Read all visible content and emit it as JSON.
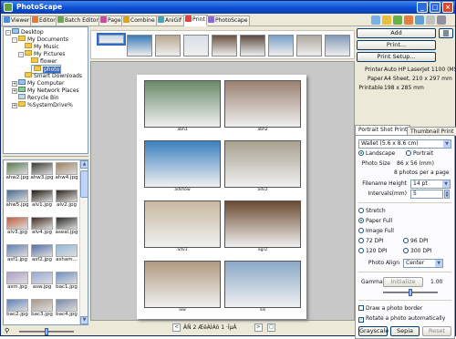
{
  "window": {
    "title": "PhotoScape",
    "min": "_",
    "max": "□",
    "close": "×"
  },
  "tabs": [
    {
      "label": "Viewer",
      "color": "#4c8adf"
    },
    {
      "label": "Editor",
      "color": "#e07a3a"
    },
    {
      "label": "Batch Editor",
      "color": "#6aa84f"
    },
    {
      "label": "Page",
      "color": "#c44f9a"
    },
    {
      "label": "Combine",
      "color": "#d9a326"
    },
    {
      "label": "AniGif",
      "color": "#4aa3b8"
    },
    {
      "label": "Print",
      "color": "#e04040"
    },
    {
      "label": "PhotoScape",
      "color": "#8a6ad0"
    }
  ],
  "tree": [
    {
      "label": "Desktop",
      "icon": "desktop-icon",
      "expander": "-"
    },
    {
      "label": "My Documents",
      "icon": "folder-icon",
      "expander": "-"
    },
    {
      "label": "My Music",
      "icon": "folder-icon",
      "expander": ""
    },
    {
      "label": "My Pictures",
      "icon": "folder-icon",
      "expander": "-"
    },
    {
      "label": "flower",
      "icon": "folder-icon",
      "expander": ""
    },
    {
      "label": "photo",
      "icon": "folder-icon",
      "expander": ""
    },
    {
      "label": "Smart Downloads",
      "icon": "folder-icon",
      "expander": ""
    },
    {
      "label": "My Computer",
      "icon": "computer-icon",
      "expander": "+"
    },
    {
      "label": "My Network Places",
      "icon": "network-icon",
      "expander": "+"
    },
    {
      "label": "Recycle Bin",
      "icon": "recycle-bin-icon",
      "expander": ""
    },
    {
      "label": "%SystemDrive%",
      "icon": "folder-icon",
      "expander": "+"
    }
  ],
  "thumbnails": [
    {
      "label": "ahw2.jpg",
      "color": "#5a7a50"
    },
    {
      "label": "ahw3.jpg",
      "color": "#3a3a30"
    },
    {
      "label": "ahw4.jpg",
      "color": "#a08060"
    },
    {
      "label": "ahw5.jpg",
      "color": "#4a6a90"
    },
    {
      "label": "alv1.jpg",
      "color": "#201810"
    },
    {
      "label": "alv2.jpg",
      "color": "#302820"
    },
    {
      "label": "alv3.jpg",
      "color": "#c06040"
    },
    {
      "label": "alv4.jpg",
      "color": "#402a20"
    },
    {
      "label": "aseal.jpg",
      "color": "#2a2a28"
    },
    {
      "label": "asf1.jpg",
      "color": "#6080b0"
    },
    {
      "label": "asf2.jpg",
      "color": "#5070a8"
    },
    {
      "label": "asham...",
      "color": "#90b8d8"
    },
    {
      "label": "asm.jpg",
      "color": "#b0a0c8"
    },
    {
      "label": "asw.jpg",
      "color": "#98a8d8"
    },
    {
      "label": "bac1.jpg",
      "color": "#7090c0"
    },
    {
      "label": "bac2.jpg",
      "color": "#6080b8"
    },
    {
      "label": "bac3.jpg",
      "color": "#a89888"
    },
    {
      "label": "bac4.jpg",
      "color": "#7888a8"
    }
  ],
  "filmstrip": [
    "#c8d8e8",
    "#3a7ab8",
    "#b8a890",
    "#d8e0e8",
    "#6a5040",
    "#5a4a40",
    "#7aa0c8",
    "#b0a8a0",
    "#8098b8"
  ],
  "preview": {
    "cells": [
      {
        "caption": "abh1",
        "color": "#6a8a6a"
      },
      {
        "caption": "abh2",
        "color": "#9a8070"
      },
      {
        "caption": "adshow",
        "color": "#3a80c0"
      },
      {
        "caption": "adv2",
        "color": "#a8a090"
      },
      {
        "caption": "adv3",
        "color": "#c8b8a0"
      },
      {
        "caption": "agr2",
        "color": "#6a4a30"
      },
      {
        "caption": "aiw",
        "color": "#b09a80"
      },
      {
        "caption": "ais",
        "color": "#8aa8c8"
      }
    ]
  },
  "pagenav": {
    "text": "ÄÑ 2 ÆëÀÌÁö 1 ·ÎµÂ",
    "prev": "<",
    "next": ">",
    "fit": "□"
  },
  "right": {
    "add": "Add",
    "print": "Print...",
    "print_setup": "Print Setup...",
    "printer_label": "Printer",
    "printer": "Auto HP LaserJet 1100 (MS",
    "paper_label": "Paper",
    "paper": "A4 Sheet, 210 x 297 mm",
    "printable_label": "Printable",
    "printable": "198 x 285 mm",
    "tab_portrait": "Portrait Shot Print",
    "tab_thumbnail": "Thumbnail Print",
    "size_select": "Wallet (5.6 x 8.6 cm)",
    "landscape": "Landscape",
    "portrait": "Portrait",
    "photo_size_label": "Photo Size",
    "photo_size": "86 x 56 (mm)",
    "photos_per_page": "8 photos per a page",
    "filename_height_label": "Filename Height",
    "filename_height": "14 pt",
    "intervals_label": "Intervals(mm)",
    "intervals": "5",
    "stretch": "Stretch",
    "paper_full": "Paper Full",
    "image_full": "Image Full",
    "dpi72": "72 DPI",
    "dpi96": "96 DPI",
    "dpi120": "120 DPI",
    "dpi300": "300 DPI",
    "photo_align_label": "Photo Align",
    "photo_align": "Center",
    "gamma_label": "Gamma",
    "initialize": "Initialize",
    "gamma_value": "1.00",
    "gamma_level": 0.5,
    "draw_border": "Draw a photo border",
    "rotate_auto": "Rotate a photo automatically",
    "grayscale": "Grayscale",
    "sepia": "Sepia",
    "reset": "Reset"
  }
}
